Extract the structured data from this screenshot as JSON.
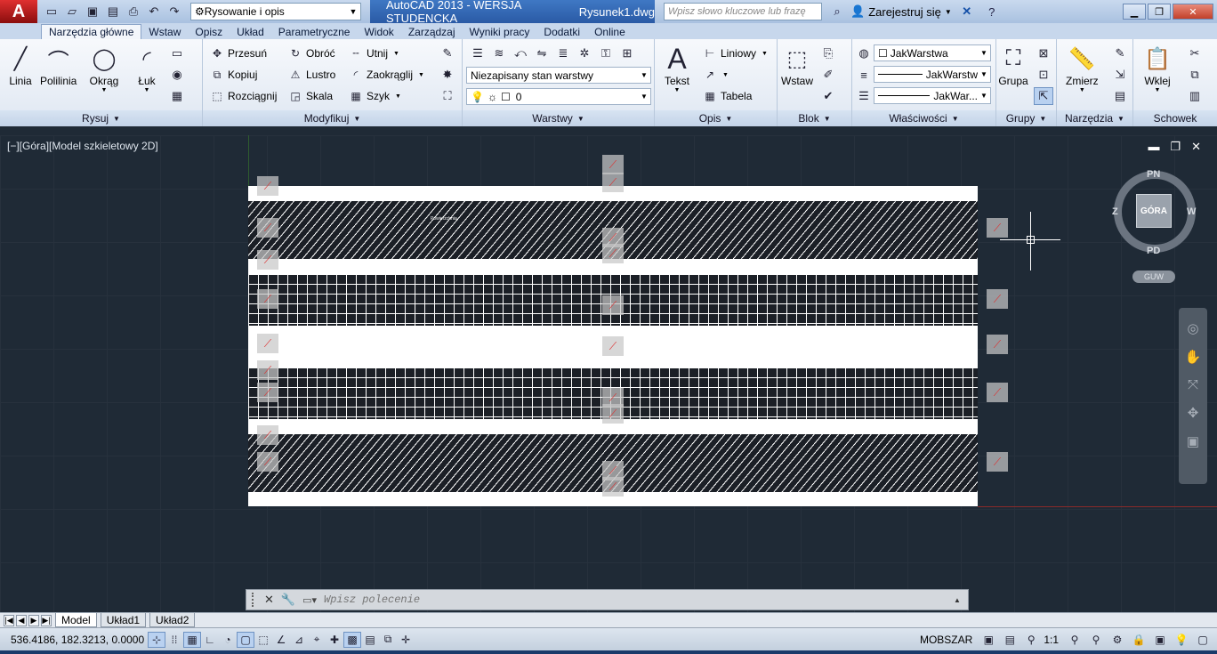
{
  "title_bar": {
    "app_button": "A",
    "workspace": "Rysowanie i opis",
    "title": "AutoCAD 2013 - WERSJA STUDENCKA",
    "file": "Rysunek1.dwg",
    "search_placeholder": "Wpisz słowo kluczowe lub frazę",
    "signin": "Zarejestruj się"
  },
  "ribbon_tabs": [
    "Narzędzia główne",
    "Wstaw",
    "Opisz",
    "Układ",
    "Parametryczne",
    "Widok",
    "Zarządzaj",
    "Wyniki pracy",
    "Dodatki",
    "Online"
  ],
  "panels": {
    "rysuj": {
      "title": "Rysuj",
      "linia": "Linia",
      "polilinia": "Polilinia",
      "okrag": "Okrąg",
      "luk": "Łuk"
    },
    "modyfikuj": {
      "title": "Modyfikuj",
      "przesun": "Przesuń",
      "obroc": "Obróć",
      "utnij": "Utnij",
      "kopiuj": "Kopiuj",
      "lustro": "Lustro",
      "zaokraglij": "Zaokrąglij",
      "rozciagnij": "Rozciągnij",
      "skala": "Skala",
      "szyk": "Szyk"
    },
    "warstwy": {
      "title": "Warstwy",
      "layer_state": "Niezapisany stan warstwy",
      "current_layer": "0"
    },
    "opis": {
      "title": "Opis",
      "tekst": "Tekst",
      "liniowy": "Liniowy",
      "tabela": "Tabela"
    },
    "blok": {
      "title": "Blok",
      "wstaw": "Wstaw"
    },
    "wlasciwosci": {
      "title": "Właściwości",
      "color": "JakWarstwa",
      "linetype": "JakWarstw",
      "lineweight": "JakWar..."
    },
    "grupy": {
      "title": "Grupy",
      "grupa": "Grupa"
    },
    "narzedzia": {
      "title": "Narzędzia",
      "zmierz": "Zmierz"
    },
    "schowek": {
      "title": "Schowek",
      "wklej": "Wklej"
    }
  },
  "viewport": {
    "label": "[−][Góra][Model szkieletowy 2D]",
    "hatch_text": "Powierzchnia"
  },
  "viewcube": {
    "top": "GÓRA",
    "north": "PN",
    "south": "PD",
    "east": "W",
    "west": "Z",
    "ucs": "GUW"
  },
  "command": {
    "placeholder": "Wpisz polecenie"
  },
  "layout_tabs": [
    "Model",
    "Układ1",
    "Układ2"
  ],
  "status": {
    "coords": "536.4186, 182.3213, 0.0000",
    "space": "MOBSZAR",
    "scale": "1:1"
  },
  "colors": {
    "canvas": "#1f2a36",
    "accent": "#3f78c4",
    "app_red": "#c41a1a"
  }
}
